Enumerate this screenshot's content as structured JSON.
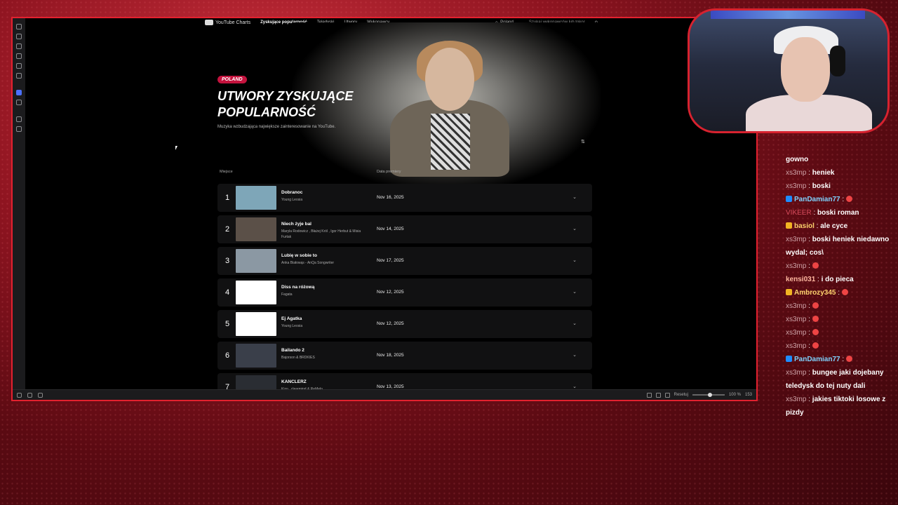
{
  "stream_chat": [
    {
      "user": "",
      "text": "gowno"
    },
    {
      "user": "xs3mp",
      "text": "heniek",
      "style": "grey"
    },
    {
      "user": "xs3mp",
      "text": "boski",
      "style": "grey"
    },
    {
      "user": "PanDamian77",
      "text": "",
      "style": "blue",
      "prefix": "blue"
    },
    {
      "user": "VIKEER",
      "text": "boski roman",
      "style": "pink"
    },
    {
      "user": "basiol",
      "text": "ale cyce",
      "style": "gold",
      "prefix": "gold"
    },
    {
      "user": "xs3mp",
      "text": "boski heniek niedawno wydal; cos\\",
      "style": "grey"
    },
    {
      "user": "xs3mp",
      "text": "",
      "style": "grey"
    },
    {
      "user": "kensi031",
      "text": "i do pieca",
      "style": "mint"
    },
    {
      "user": "Ambrozy345",
      "text": "",
      "style": "gold",
      "prefix": "gold"
    },
    {
      "user": "xs3mp",
      "text": "",
      "style": "grey"
    },
    {
      "user": "xs3mp",
      "text": "",
      "style": "grey"
    },
    {
      "user": "xs3mp",
      "text": "",
      "style": "grey"
    },
    {
      "user": "xs3mp",
      "text": "",
      "style": "grey"
    },
    {
      "user": "PanDamian77",
      "text": "",
      "style": "blue",
      "prefix": "blue"
    },
    {
      "user": "xs3mp",
      "text": "bungee jaki dojebany teledysk do tej nuty dali",
      "style": "grey"
    },
    {
      "user": "xs3mp",
      "text": "jakies tiktoki losowe z pizdy",
      "style": "grey"
    }
  ],
  "page": {
    "nav": {
      "logo": "YouTube Charts",
      "items": [
        "Zyskujące popularność",
        "Teledyski",
        "Utwory",
        "Wykonawcy"
      ],
      "country": "Poland",
      "search_placeholder": "Szukaj wykonawców lub tokor"
    },
    "badge": "POLAND",
    "title": "UTWORY ZYSKUJĄCE POPULARNOŚĆ",
    "subtitle": "Muzyka wzbudzająca największe zainteresowanie na YouTube.",
    "col_rank": "Miejsce",
    "col_date": "Data premiery",
    "rows": [
      {
        "rank": "1",
        "title": "Dobranoc",
        "artist": "Young Leosia",
        "date": "Nov 16, 2025",
        "thumb": "#7ea6b8"
      },
      {
        "rank": "2",
        "title": "Niech żyje bal",
        "artist": "Maryla Rodowicz , Błażej Król , Igor Herbut & Misia Furtak",
        "date": "Nov 14, 2025",
        "thumb": "#5b5048"
      },
      {
        "rank": "3",
        "title": "Lubię w sobie to",
        "artist": "Anka Białowąs - AnQa Songwriter",
        "date": "Nov 17, 2025",
        "thumb": "#8b98a3"
      },
      {
        "rank": "4",
        "title": "Diss na różową",
        "artist": "Fagata",
        "date": "Nov 12, 2025",
        "thumb": "#ffffff"
      },
      {
        "rank": "5",
        "title": "Ej Agatka",
        "artist": "Young Leosia",
        "date": "Nov 12, 2025",
        "thumb": "#ffffff"
      },
      {
        "rank": "6",
        "title": "Bailando 2",
        "artist": "Bajorson & BRDKIES",
        "date": "Nov 18, 2025",
        "thumb": "#3a3f4a"
      },
      {
        "rank": "7",
        "title": "KANCLERZ",
        "artist": "Kizo , clearmind & ReMelo",
        "date": "Nov 13, 2025",
        "thumb": "#2a2d33"
      }
    ]
  },
  "statusbar": {
    "reset": "Resetuj",
    "zoom": "100 %",
    "zoom_fraction": 0.55,
    "num": "153"
  },
  "colors": {
    "accent": "#e3212f",
    "badge": "#c4133e"
  }
}
